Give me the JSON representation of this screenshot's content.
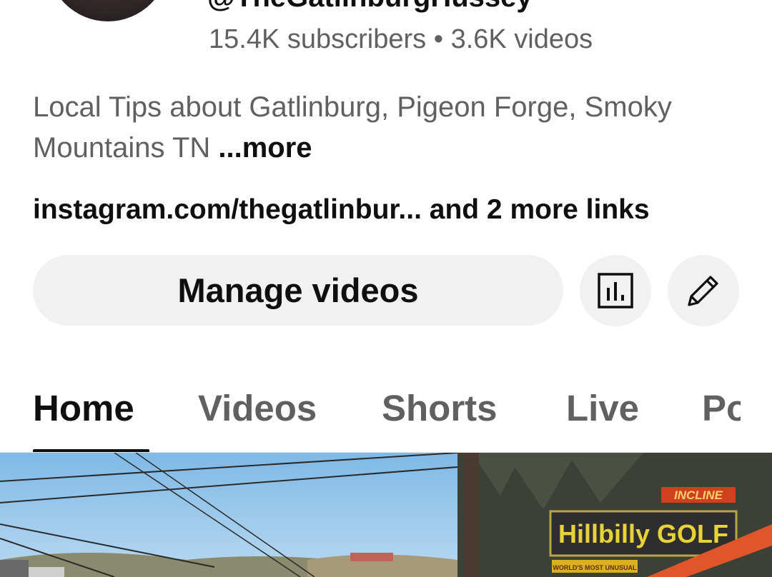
{
  "channel": {
    "handle": "@TheGatlinburgHussey",
    "stats": "15.4K subscribers • 3.6K videos",
    "description": "Local Tips about Gatlinburg, Pigeon Forge, Smoky Mountains TN",
    "more_label": "...more",
    "links_text": "instagram.com/thegatlinbur... and 2 more links"
  },
  "actions": {
    "manage_label": "Manage videos",
    "analytics_icon": "analytics-icon",
    "edit_icon": "pencil-icon"
  },
  "tabs": [
    {
      "label": "Home",
      "active": true
    },
    {
      "label": "Videos",
      "active": false
    },
    {
      "label": "Shorts",
      "active": false
    },
    {
      "label": "Live",
      "active": false
    },
    {
      "label": "Po",
      "active": false
    }
  ],
  "thumbnail": {
    "sign_main": "Hillbilly GOLF",
    "sign_top": "INCLINE",
    "sign_sub": "WORLD'S MOST UNUSUAL"
  },
  "colors": {
    "text_primary": "#0f0f0f",
    "text_secondary": "#606060",
    "button_bg": "#f1f1f1"
  }
}
